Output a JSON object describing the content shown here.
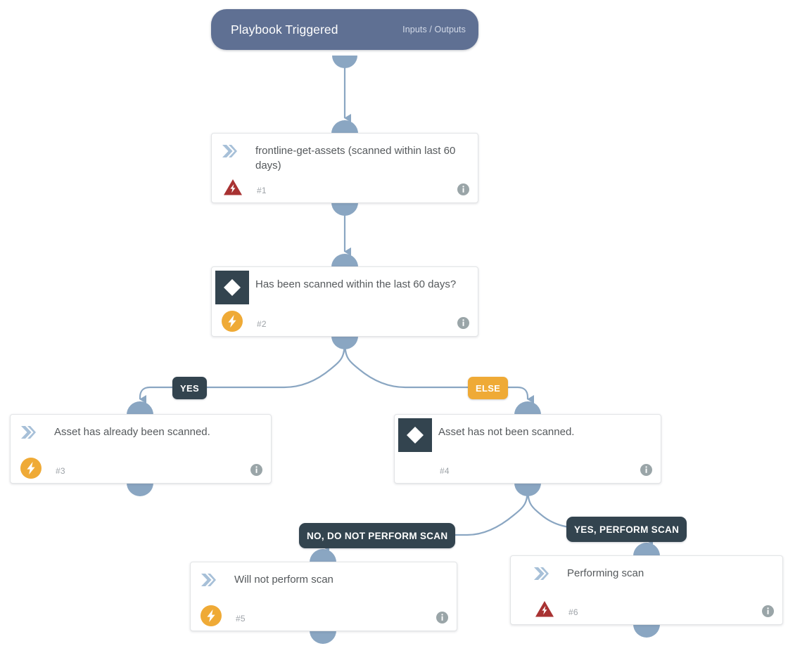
{
  "diagram": {
    "type": "playbook-flow",
    "title_text": "Playbook Triggered",
    "colors": {
      "trigger_fill": "#5f7093",
      "card_fill": "#ffffff",
      "card_border": "#e2e4e6",
      "connector": "#8aa6c2",
      "decision_icon_fill": "#33444f",
      "chevron_icon_fill": "#a7c0d8",
      "bolt_badge_fill": "#efaa36",
      "warning_badge_fill": "#a83232",
      "info_icon_fill": "#9aa5a8",
      "branch_dark": "#33444f",
      "branch_amber": "#efaa36",
      "title_text": "#55595c",
      "number_text": "#9ea3a8"
    }
  },
  "trigger": {
    "label": "Playbook Triggered",
    "io_label": "Inputs / Outputs"
  },
  "nodes": [
    {
      "id": "node-1",
      "title": "frontline-get-assets (scanned within last 60 days)",
      "number": "#1",
      "type_icon": "chevron-icon",
      "status_icon": "warning-bolt-icon",
      "info_icon": "info-icon"
    },
    {
      "id": "node-2",
      "title": "Has been scanned within the last 60 days?",
      "number": "#2",
      "type_icon": "decision-diamond-icon",
      "status_icon": "bolt-circle-icon",
      "info_icon": "info-icon"
    },
    {
      "id": "node-3",
      "title": "Asset has already been scanned.",
      "number": "#3",
      "type_icon": "chevron-icon",
      "status_icon": "bolt-circle-icon",
      "info_icon": "info-icon"
    },
    {
      "id": "node-4",
      "title": "Asset has not been scanned.",
      "number": "#4",
      "type_icon": "decision-diamond-icon",
      "status_icon": "",
      "info_icon": "info-icon"
    },
    {
      "id": "node-5",
      "title": "Will not perform scan",
      "number": "#5",
      "type_icon": "chevron-icon",
      "status_icon": "bolt-circle-icon",
      "info_icon": "info-icon"
    },
    {
      "id": "node-6",
      "title": "Performing scan",
      "number": "#6",
      "type_icon": "chevron-icon",
      "status_icon": "warning-bolt-icon",
      "info_icon": "info-icon"
    }
  ],
  "branches": [
    {
      "id": "branch-yes",
      "label": "YES",
      "style": "dark",
      "from": "node-2",
      "to": "node-3"
    },
    {
      "id": "branch-else",
      "label": "ELSE",
      "style": "amber",
      "from": "node-2",
      "to": "node-4"
    },
    {
      "id": "branch-no-scan",
      "label": "NO, DO NOT PERFORM SCAN",
      "style": "dark",
      "from": "node-4",
      "to": "node-5"
    },
    {
      "id": "branch-yes-scan",
      "label": "YES, PERFORM SCAN",
      "style": "dark",
      "from": "node-4",
      "to": "node-6"
    }
  ]
}
